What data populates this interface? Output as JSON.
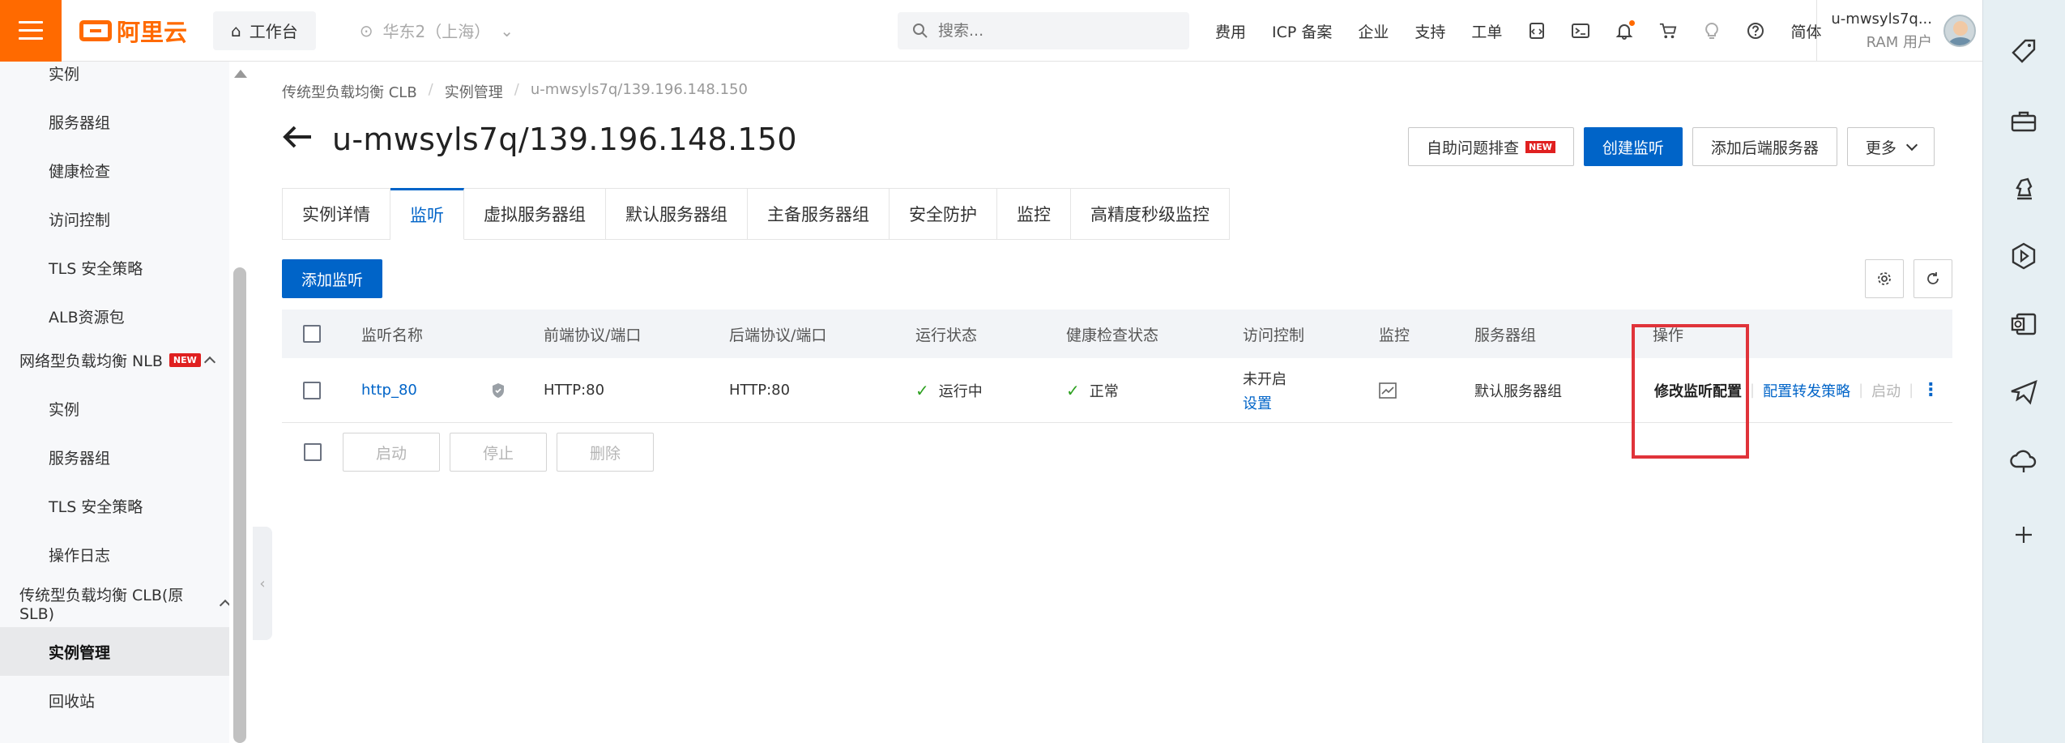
{
  "header": {
    "logo_text": "阿里云",
    "workbench_label": "工作台",
    "region_label": "华东2（上海）",
    "search_placeholder": "搜索...",
    "nav_links": [
      "费用",
      "ICP 备案",
      "企业",
      "支持",
      "工单"
    ],
    "lang_label": "简体",
    "user_name": "u-mwsyls7q...",
    "user_role": "RAM 用户"
  },
  "sidebar": {
    "items": [
      {
        "label": "实例",
        "kind": "child"
      },
      {
        "label": "服务器组",
        "kind": "child"
      },
      {
        "label": "健康检查",
        "kind": "child"
      },
      {
        "label": "访问控制",
        "kind": "child"
      },
      {
        "label": "TLS 安全策略",
        "kind": "child"
      },
      {
        "label": "ALB资源包",
        "kind": "child"
      },
      {
        "label": "网络型负载均衡 NLB",
        "kind": "group",
        "badge": "NEW"
      },
      {
        "label": "实例",
        "kind": "child"
      },
      {
        "label": "服务器组",
        "kind": "child"
      },
      {
        "label": "TLS 安全策略",
        "kind": "child"
      },
      {
        "label": "操作日志",
        "kind": "child"
      },
      {
        "label": "传统型负载均衡 CLB(原SLB)",
        "kind": "group"
      },
      {
        "label": "实例管理",
        "kind": "child",
        "active": true
      },
      {
        "label": "回收站",
        "kind": "child"
      }
    ]
  },
  "breadcrumb": [
    "传统型负载均衡 CLB",
    "实例管理",
    "u-mwsyls7q/139.196.148.150"
  ],
  "page_title": "u-mwsyls7q/139.196.148.150",
  "actions": {
    "self_check": "自助问题排查",
    "self_check_badge": "NEW",
    "create_listener": "创建监听",
    "add_backend": "添加后端服务器",
    "more": "更多"
  },
  "tabs": [
    "实例详情",
    "监听",
    "虚拟服务器组",
    "默认服务器组",
    "主备服务器组",
    "安全防护",
    "监控",
    "高精度秒级监控"
  ],
  "active_tab": "监听",
  "add_listener_label": "添加监听",
  "table": {
    "headers": [
      "监听名称",
      "前端协议/端口",
      "后端协议/端口",
      "运行状态",
      "健康检查状态",
      "访问控制",
      "监控",
      "服务器组",
      "操作"
    ],
    "rows": [
      {
        "name": "http_80",
        "frontend": "HTTP:80",
        "backend": "HTTP:80",
        "status": "运行中",
        "health": "正常",
        "acl_status": "未开启",
        "acl_link": "设置",
        "server_group": "默认服务器组",
        "op_modify": "修改监听配置",
        "op_forward": "配置转发策略",
        "op_start": "启动"
      }
    ]
  },
  "bulk_actions": [
    "启动",
    "停止",
    "删除"
  ],
  "colors": {
    "brand": "#ff6a00",
    "primary": "#0064c8",
    "success": "#2ea121",
    "highlight": "#e0333a"
  }
}
